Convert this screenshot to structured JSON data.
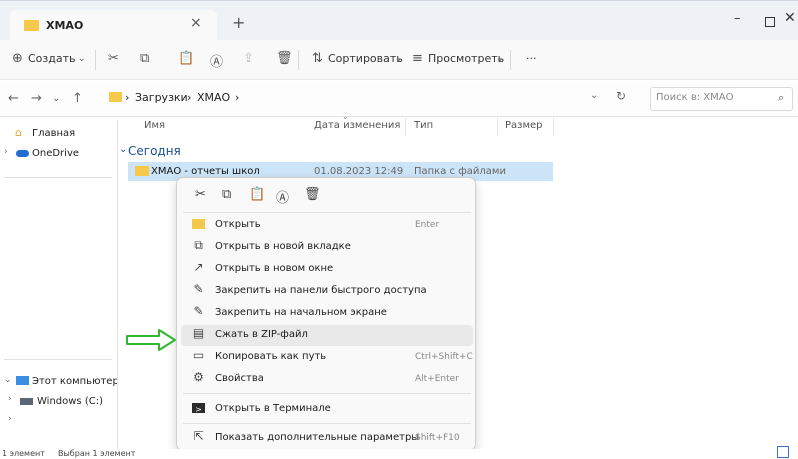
{
  "tab": {
    "title": "ХМАО",
    "close": "×",
    "new": "+"
  },
  "window": {
    "minimize": "–",
    "close": "✕"
  },
  "toolbar": {
    "create": "Создать",
    "sort": "Сортировать",
    "view": "Просмотреть",
    "more": "···"
  },
  "address": {
    "crumbs": [
      "Загрузки",
      "ХМАО"
    ],
    "separator": "›",
    "search_placeholder": "Поиск в: ХМАО"
  },
  "sidebar": {
    "home": "Главная",
    "onedrive": "OneDrive",
    "this_pc": "Этот компьютер",
    "windows_c": "Windows (C:)"
  },
  "columns": {
    "name": "Имя",
    "date": "Дата изменения",
    "type": "Тип",
    "size": "Размер"
  },
  "group": {
    "label": "Сегодня"
  },
  "row": {
    "name": "ХМАО - отчеты школ",
    "date": "01.08.2023 12:49",
    "type": "Папка с файлами"
  },
  "context_menu": {
    "items": [
      {
        "label": "Открыть",
        "shortcut": "Enter",
        "icon": "folder-icon"
      },
      {
        "label": "Открыть в новой вкладке",
        "shortcut": "",
        "icon": "new-tab-icon"
      },
      {
        "label": "Открыть в новом окне",
        "shortcut": "",
        "icon": "new-window-icon"
      },
      {
        "label": "Закрепить на панели быстрого доступа",
        "shortcut": "",
        "icon": "pin-icon"
      },
      {
        "label": "Закрепить на начальном экране",
        "shortcut": "",
        "icon": "pin-icon"
      },
      {
        "label": "Сжать в ZIP-файл",
        "shortcut": "",
        "icon": "zip-icon"
      },
      {
        "label": "Копировать как путь",
        "shortcut": "Ctrl+Shift+C",
        "icon": "copy-path-icon"
      },
      {
        "label": "Свойства",
        "shortcut": "Alt+Enter",
        "icon": "wrench-icon"
      },
      {
        "label": "Открыть в Терминале",
        "shortcut": "",
        "icon": "terminal-icon"
      },
      {
        "label": "Показать дополнительные параметры",
        "shortcut": "Shift+F10",
        "icon": "more-options-icon"
      }
    ]
  },
  "status": {
    "count": "1 элемент",
    "selected": "Выбран 1 элемент"
  },
  "colors": {
    "accent": "#3a73c9",
    "selection": "#cce4f7",
    "folder": "#f6c94a",
    "arrow": "#2eb82e"
  }
}
